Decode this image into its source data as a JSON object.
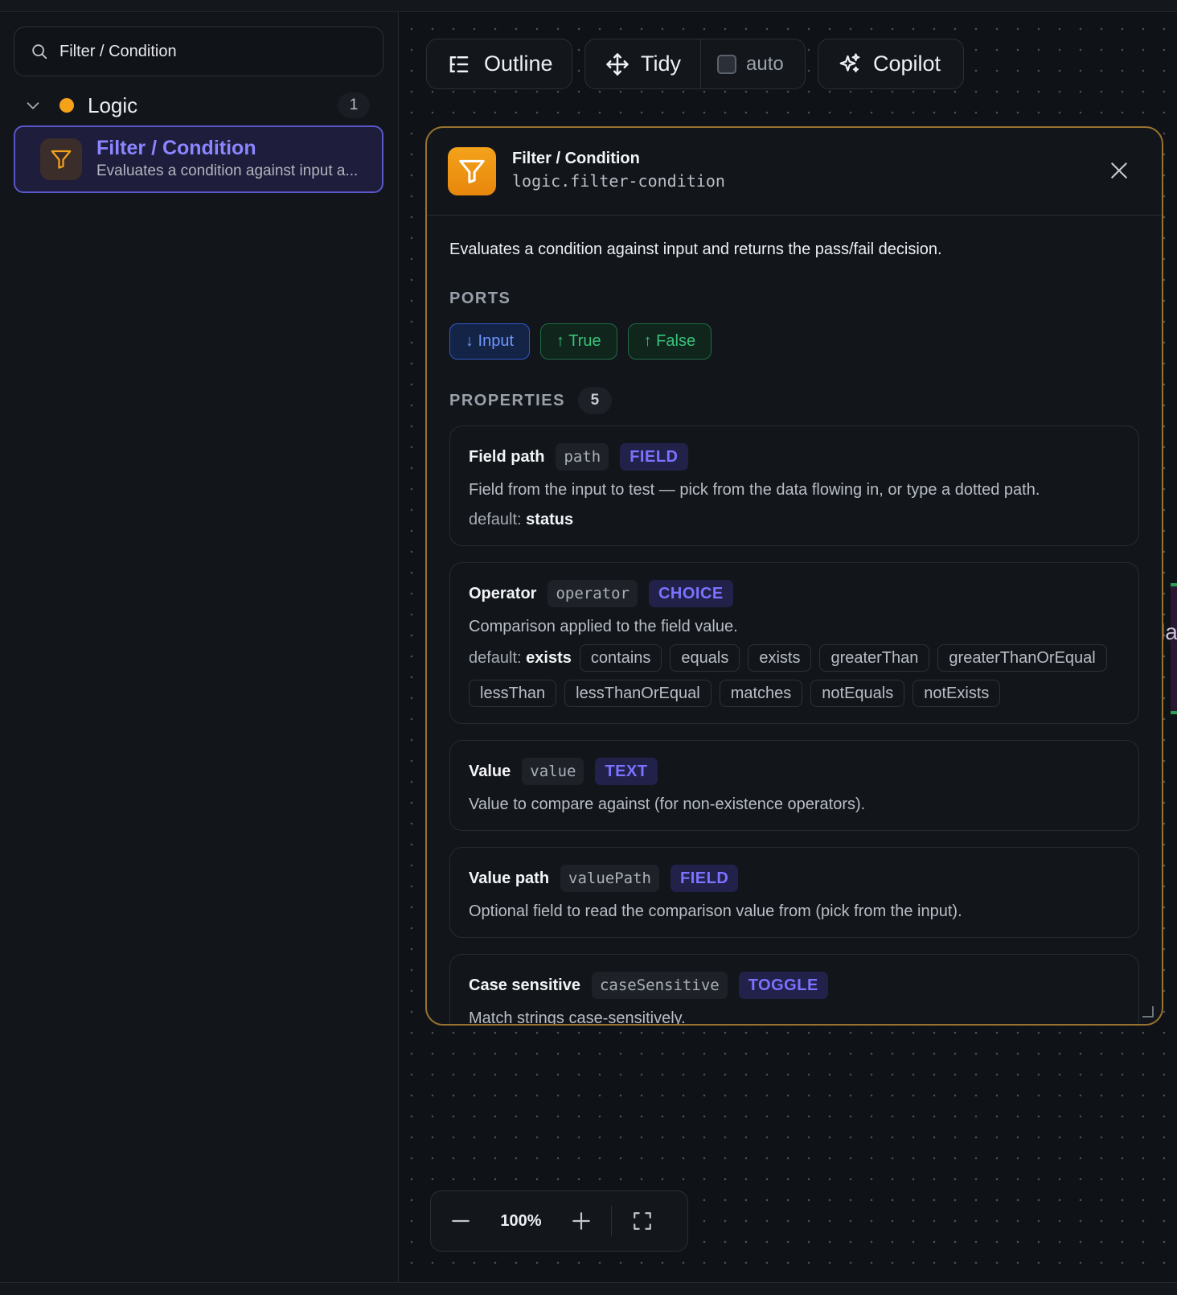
{
  "search": {
    "placeholder": "Filter / Condition",
    "value": "Filter / Condition",
    "icon": "search-icon"
  },
  "sidebar": {
    "group": {
      "label": "Logic",
      "count": "1",
      "dot_color": "#f6a219"
    },
    "items": [
      {
        "title": "Filter / Condition",
        "subtitle": "Evaluates a condition against input a...",
        "icon": "filter-icon"
      }
    ]
  },
  "toolbar": {
    "outline_label": "Outline",
    "tidy_label": "Tidy",
    "auto_label": "auto",
    "auto_checked": false,
    "copilot_label": "Copilot"
  },
  "panel": {
    "title": "Filter / Condition",
    "id": "logic.filter-condition",
    "description": "Evaluates a condition against input and returns the pass/fail decision.",
    "ports_label": "PORTS",
    "ports": [
      {
        "label": "↓ Input",
        "kind": "input"
      },
      {
        "label": "↑ True",
        "kind": "output"
      },
      {
        "label": "↑ False",
        "kind": "output"
      }
    ],
    "properties_label": "PROPERTIES",
    "properties_count": "5",
    "properties": [
      {
        "name": "Field path",
        "key": "path",
        "type": "FIELD",
        "description": "Field from the input to test — pick from the data flowing in, or type a dotted path.",
        "default_label": "default:",
        "default_value": "status"
      },
      {
        "name": "Operator",
        "key": "operator",
        "type": "CHOICE",
        "description": "Comparison applied to the field value.",
        "default_label": "default:",
        "default_value": "exists",
        "options": [
          "contains",
          "equals",
          "exists",
          "greaterThan",
          "greaterThanOrEqual",
          "lessThan",
          "lessThanOrEqual",
          "matches",
          "notEquals",
          "notExists"
        ]
      },
      {
        "name": "Value",
        "key": "value",
        "type": "TEXT",
        "description": "Value to compare against (for non-existence operators)."
      },
      {
        "name": "Value path",
        "key": "valuePath",
        "type": "FIELD",
        "description": "Optional field to read the comparison value from (pick from the input)."
      },
      {
        "name": "Case sensitive",
        "key": "caseSensitive",
        "type": "TOGGLE",
        "description": "Match strings case-sensitively."
      }
    ]
  },
  "peek": {
    "text": "la"
  },
  "zoom": {
    "level": "100%"
  },
  "colors": {
    "accent": "#8b85ff",
    "node": "#f4a21b",
    "true_false": "#38c27a",
    "input": "#6d96ff"
  }
}
